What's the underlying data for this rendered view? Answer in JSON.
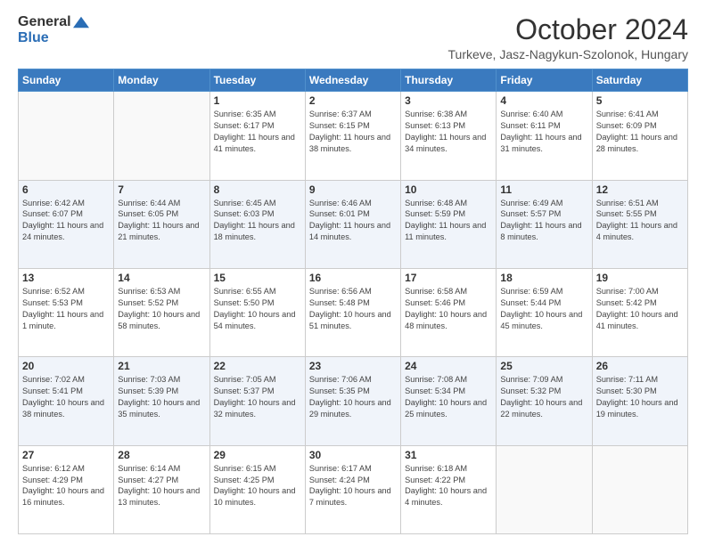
{
  "header": {
    "logo_general": "General",
    "logo_blue": "Blue",
    "month_title": "October 2024",
    "location": "Turkeve, Jasz-Nagykun-Szolonok, Hungary"
  },
  "weekdays": [
    "Sunday",
    "Monday",
    "Tuesday",
    "Wednesday",
    "Thursday",
    "Friday",
    "Saturday"
  ],
  "weeks": [
    [
      {
        "day": "",
        "info": ""
      },
      {
        "day": "",
        "info": ""
      },
      {
        "day": "1",
        "info": "Sunrise: 6:35 AM\nSunset: 6:17 PM\nDaylight: 11 hours and 41 minutes."
      },
      {
        "day": "2",
        "info": "Sunrise: 6:37 AM\nSunset: 6:15 PM\nDaylight: 11 hours and 38 minutes."
      },
      {
        "day": "3",
        "info": "Sunrise: 6:38 AM\nSunset: 6:13 PM\nDaylight: 11 hours and 34 minutes."
      },
      {
        "day": "4",
        "info": "Sunrise: 6:40 AM\nSunset: 6:11 PM\nDaylight: 11 hours and 31 minutes."
      },
      {
        "day": "5",
        "info": "Sunrise: 6:41 AM\nSunset: 6:09 PM\nDaylight: 11 hours and 28 minutes."
      }
    ],
    [
      {
        "day": "6",
        "info": "Sunrise: 6:42 AM\nSunset: 6:07 PM\nDaylight: 11 hours and 24 minutes."
      },
      {
        "day": "7",
        "info": "Sunrise: 6:44 AM\nSunset: 6:05 PM\nDaylight: 11 hours and 21 minutes."
      },
      {
        "day": "8",
        "info": "Sunrise: 6:45 AM\nSunset: 6:03 PM\nDaylight: 11 hours and 18 minutes."
      },
      {
        "day": "9",
        "info": "Sunrise: 6:46 AM\nSunset: 6:01 PM\nDaylight: 11 hours and 14 minutes."
      },
      {
        "day": "10",
        "info": "Sunrise: 6:48 AM\nSunset: 5:59 PM\nDaylight: 11 hours and 11 minutes."
      },
      {
        "day": "11",
        "info": "Sunrise: 6:49 AM\nSunset: 5:57 PM\nDaylight: 11 hours and 8 minutes."
      },
      {
        "day": "12",
        "info": "Sunrise: 6:51 AM\nSunset: 5:55 PM\nDaylight: 11 hours and 4 minutes."
      }
    ],
    [
      {
        "day": "13",
        "info": "Sunrise: 6:52 AM\nSunset: 5:53 PM\nDaylight: 11 hours and 1 minute."
      },
      {
        "day": "14",
        "info": "Sunrise: 6:53 AM\nSunset: 5:52 PM\nDaylight: 10 hours and 58 minutes."
      },
      {
        "day": "15",
        "info": "Sunrise: 6:55 AM\nSunset: 5:50 PM\nDaylight: 10 hours and 54 minutes."
      },
      {
        "day": "16",
        "info": "Sunrise: 6:56 AM\nSunset: 5:48 PM\nDaylight: 10 hours and 51 minutes."
      },
      {
        "day": "17",
        "info": "Sunrise: 6:58 AM\nSunset: 5:46 PM\nDaylight: 10 hours and 48 minutes."
      },
      {
        "day": "18",
        "info": "Sunrise: 6:59 AM\nSunset: 5:44 PM\nDaylight: 10 hours and 45 minutes."
      },
      {
        "day": "19",
        "info": "Sunrise: 7:00 AM\nSunset: 5:42 PM\nDaylight: 10 hours and 41 minutes."
      }
    ],
    [
      {
        "day": "20",
        "info": "Sunrise: 7:02 AM\nSunset: 5:41 PM\nDaylight: 10 hours and 38 minutes."
      },
      {
        "day": "21",
        "info": "Sunrise: 7:03 AM\nSunset: 5:39 PM\nDaylight: 10 hours and 35 minutes."
      },
      {
        "day": "22",
        "info": "Sunrise: 7:05 AM\nSunset: 5:37 PM\nDaylight: 10 hours and 32 minutes."
      },
      {
        "day": "23",
        "info": "Sunrise: 7:06 AM\nSunset: 5:35 PM\nDaylight: 10 hours and 29 minutes."
      },
      {
        "day": "24",
        "info": "Sunrise: 7:08 AM\nSunset: 5:34 PM\nDaylight: 10 hours and 25 minutes."
      },
      {
        "day": "25",
        "info": "Sunrise: 7:09 AM\nSunset: 5:32 PM\nDaylight: 10 hours and 22 minutes."
      },
      {
        "day": "26",
        "info": "Sunrise: 7:11 AM\nSunset: 5:30 PM\nDaylight: 10 hours and 19 minutes."
      }
    ],
    [
      {
        "day": "27",
        "info": "Sunrise: 6:12 AM\nSunset: 4:29 PM\nDaylight: 10 hours and 16 minutes."
      },
      {
        "day": "28",
        "info": "Sunrise: 6:14 AM\nSunset: 4:27 PM\nDaylight: 10 hours and 13 minutes."
      },
      {
        "day": "29",
        "info": "Sunrise: 6:15 AM\nSunset: 4:25 PM\nDaylight: 10 hours and 10 minutes."
      },
      {
        "day": "30",
        "info": "Sunrise: 6:17 AM\nSunset: 4:24 PM\nDaylight: 10 hours and 7 minutes."
      },
      {
        "day": "31",
        "info": "Sunrise: 6:18 AM\nSunset: 4:22 PM\nDaylight: 10 hours and 4 minutes."
      },
      {
        "day": "",
        "info": ""
      },
      {
        "day": "",
        "info": ""
      }
    ]
  ]
}
